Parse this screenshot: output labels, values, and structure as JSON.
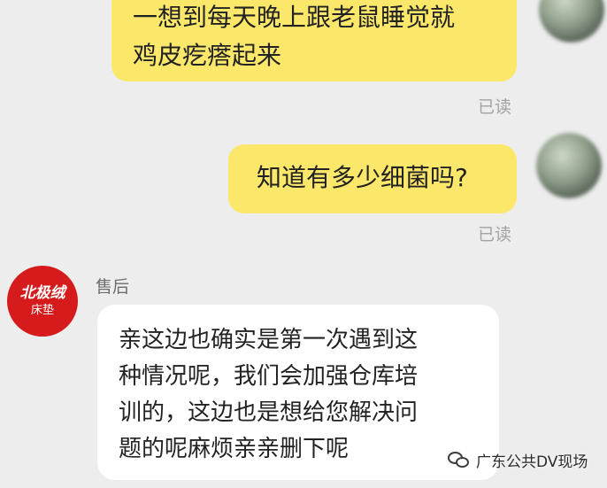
{
  "messages": [
    {
      "side": "right",
      "lines": [
        "一想到每天晚上跟老鼠睡觉就",
        "鸡皮疙瘩起来"
      ],
      "status": "已读"
    },
    {
      "side": "right",
      "lines": [
        "知道有多少细菌吗?"
      ],
      "status": "已读"
    },
    {
      "side": "left",
      "sender": "售后",
      "lines": [
        "亲这边也确实是第一次遇到这",
        "种情况呢，我们会加强仓库培",
        "训的，这边也是想给您解决问",
        "题的呢麻烦亲亲删下呢"
      ]
    }
  ],
  "store_avatar": {
    "line1": "北极绒",
    "line2": "床垫",
    "color": "#d51b1b"
  },
  "watermark": {
    "icon": "wechat-icon",
    "text": "广东公共DV现场"
  },
  "colors": {
    "outgoing_bubble": "#fbe86b",
    "incoming_bubble": "#ffffff",
    "background": "#ededed",
    "read_status": "#a3a3a3"
  }
}
